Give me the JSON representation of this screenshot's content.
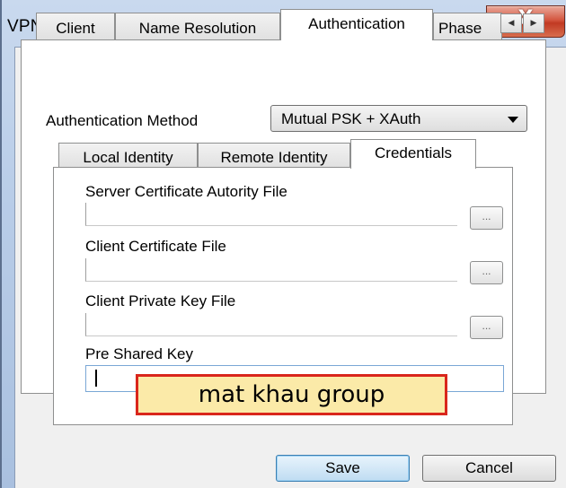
{
  "window": {
    "title": "VPN Site Configuration",
    "close_glyph": "X"
  },
  "tabs": [
    {
      "label": "Client",
      "active": false
    },
    {
      "label": "Name Resolution",
      "active": false
    },
    {
      "label": "Authentication",
      "active": true
    },
    {
      "label": "Phase",
      "active": false
    }
  ],
  "tab_scroll": {
    "left_icon": "scroll-left-icon",
    "right_icon": "scroll-right-icon"
  },
  "authentication": {
    "method_label": "Authentication Method",
    "method_value": "Mutual PSK + XAuth"
  },
  "inner_tabs": [
    {
      "label": "Local Identity",
      "active": false
    },
    {
      "label": "Remote Identity",
      "active": false
    },
    {
      "label": "Credentials",
      "active": true
    }
  ],
  "credentials": {
    "server_ca_label": "Server Certificate Autority File",
    "server_ca_value": "",
    "client_cert_label": "Client Certificate File",
    "client_cert_value": "",
    "client_key_label": "Client Private Key File",
    "client_key_value": "",
    "browse_label": "...",
    "psk_label": "Pre Shared Key",
    "psk_value": ""
  },
  "annotation": {
    "text": "mat khau group"
  },
  "buttons": {
    "save": "Save",
    "cancel": "Cancel"
  }
}
